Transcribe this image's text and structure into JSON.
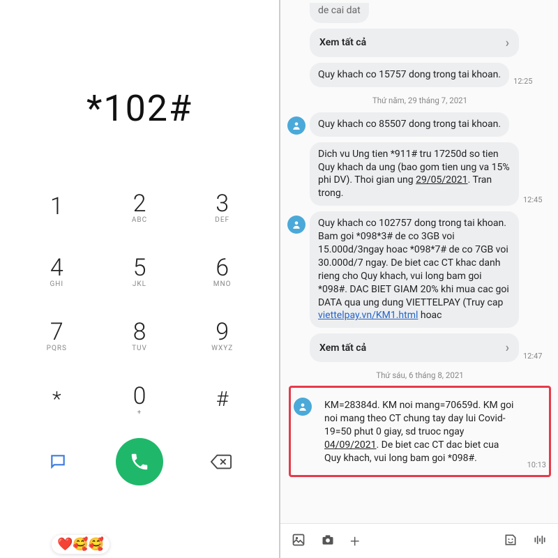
{
  "dialer": {
    "entered": "*102#",
    "keys": [
      {
        "d": "1",
        "s": ""
      },
      {
        "d": "2",
        "s": "ABC"
      },
      {
        "d": "3",
        "s": "DEF"
      },
      {
        "d": "4",
        "s": "GHI"
      },
      {
        "d": "5",
        "s": "JKL"
      },
      {
        "d": "6",
        "s": "MNO"
      },
      {
        "d": "7",
        "s": "PQRS"
      },
      {
        "d": "8",
        "s": "TUV"
      },
      {
        "d": "9",
        "s": "WXYZ"
      },
      {
        "d": "*",
        "s": ""
      },
      {
        "d": "0",
        "s": "+"
      },
      {
        "d": "#",
        "s": ""
      }
    ],
    "reactions": "❤️🥰🥰"
  },
  "chat": {
    "cutoff_top": "de cai dat",
    "view_all": "Xem tất cả",
    "m1": {
      "text": "Quy khach co 15757 dong trong tai khoan.",
      "time": "12:25"
    },
    "date1": "Thứ năm, 29 tháng 7, 2021",
    "m2": {
      "text": "Quy khach co 85507 dong trong tai khoan."
    },
    "m3": {
      "pre": "Dich vu Ung tien *911# tru 17250d so tien Quy khach da ung (bao gom tien ung va 15% phi DV). Thoi gian ung ",
      "date": "29/05/2021",
      "post": ". Tran trong.",
      "time": "12:45"
    },
    "m4": {
      "pre": "Quy khach co 102757 dong trong tai khoan. Bam goi *098*3# de co 3GB voi 15.000d/3ngay hoac *098*7# de co 7GB voi 30.000d/7 ngay. De biet cac CT khac danh rieng cho Quy khach, vui long bam goi *098#. DAC BIET GIAM 20% khi mua cac goi DATA qua ung dung VIETTELPAY (Truy cap ",
      "link": "viettelpay.vn/KM1.html",
      "post": " hoac",
      "time": "12:47"
    },
    "date2": "Thứ sáu, 6 tháng 8, 2021",
    "m5": {
      "pre": "KM=28384d. KM noi mang=70659d. KM goi noi mang theo CT chung tay day lui Covid-19=50 phut 0 giay, sd truoc ngay ",
      "date": "04/09/2021",
      "post": ". De biet cac CT dac biet cua Quy khach, vui long bam goi *098#.",
      "time": "10:13"
    }
  }
}
